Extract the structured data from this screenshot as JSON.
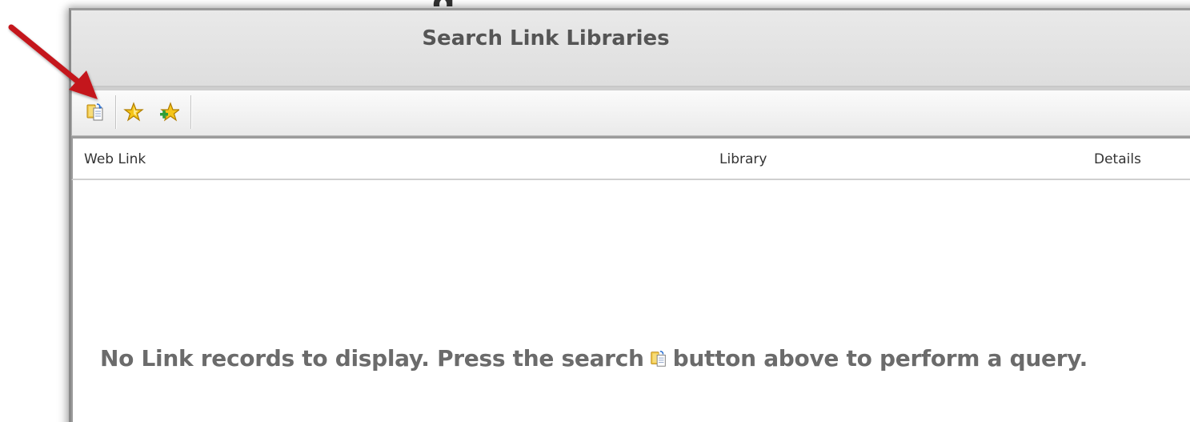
{
  "window": {
    "title": "Search Link Libraries"
  },
  "toolbar": {
    "buttons": [
      {
        "name": "search",
        "icon": "search-records-icon"
      },
      {
        "name": "favorite",
        "icon": "star-icon"
      },
      {
        "name": "add-favorite",
        "icon": "star-add-icon"
      }
    ]
  },
  "columns": {
    "web_link": "Web Link",
    "library": "Library",
    "details": "Details"
  },
  "empty_state": {
    "before": "No Link records to display. Press the search",
    "after": "button above to perform a query."
  },
  "colors": {
    "arrow": "#c4161c",
    "title_text": "#555555",
    "empty_text": "#6b6b6b"
  }
}
